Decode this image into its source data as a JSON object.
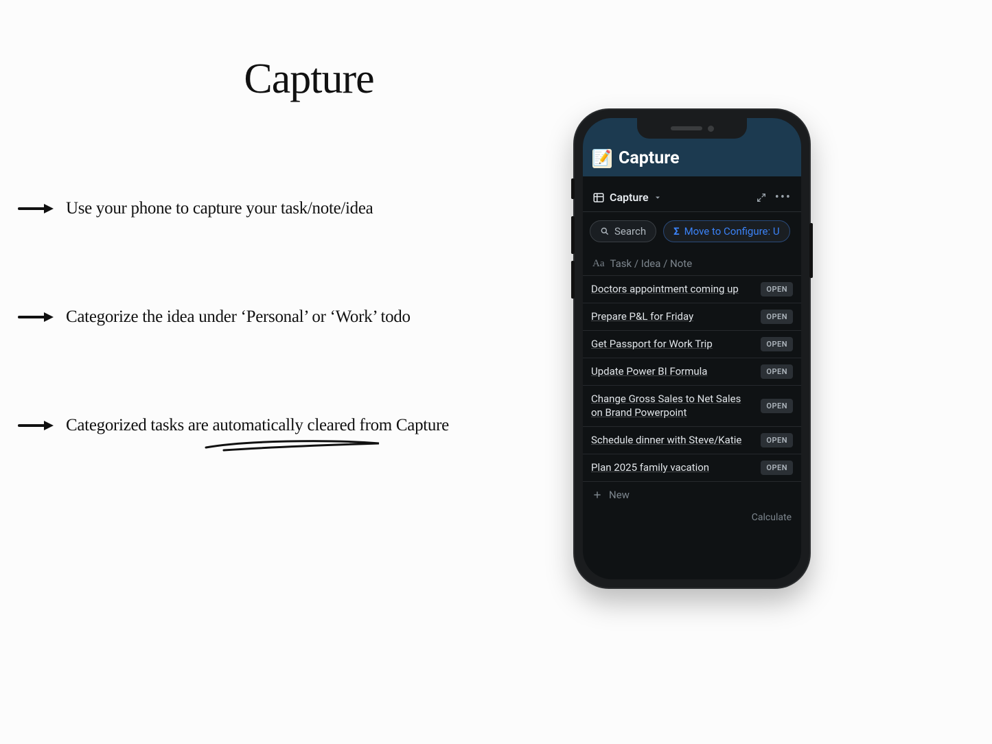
{
  "heading": "Capture",
  "bullets": [
    "Use your phone to capture your task/note/idea",
    "Categorize the idea under ‘Personal’ or ‘Work’ todo",
    "Categorized tasks are automatically cleared from Capture"
  ],
  "phone": {
    "app_title": "Capture",
    "view_name": "Capture",
    "search_label": "Search",
    "move_label": "Move to Configure: U",
    "column_header": "Task / Idea / Note",
    "open_label": "OPEN",
    "new_label": "New",
    "calculate_label": "Calculate",
    "tasks": [
      "Doctors appointment coming up",
      "Prepare P&L for Friday",
      "Get Passport for Work Trip",
      "Update Power BI Formula",
      "Change Gross Sales to Net Sales on Brand Powerpoint",
      "Schedule dinner with Steve/Katie",
      "Plan 2025 family vacation"
    ]
  }
}
